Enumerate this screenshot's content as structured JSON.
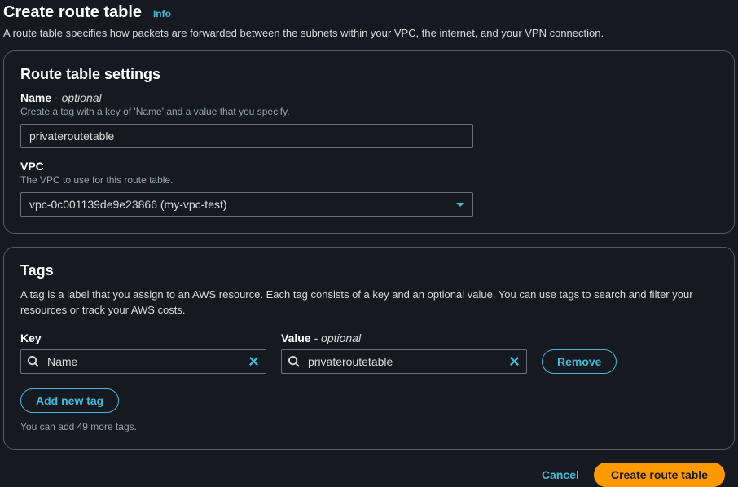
{
  "header": {
    "title": "Create route table",
    "info_label": "Info",
    "description": "A route table specifies how packets are forwarded between the subnets within your VPC, the internet, and your VPN connection."
  },
  "settings_panel": {
    "title": "Route table settings",
    "name_field": {
      "label": "Name",
      "optional_suffix": " - optional",
      "hint": "Create a tag with a key of 'Name' and a value that you specify.",
      "value": "privateroutetable"
    },
    "vpc_field": {
      "label": "VPC",
      "hint": "The VPC to use for this route table.",
      "selected": "vpc-0c001139de9e23866 (my-vpc-test)"
    }
  },
  "tags_panel": {
    "title": "Tags",
    "description": "A tag is a label that you assign to an AWS resource. Each tag consists of a key and an optional value. You can use tags to search and filter your resources or track your AWS costs.",
    "key_label": "Key",
    "value_label": "Value",
    "value_optional_suffix": " - optional",
    "rows": [
      {
        "key": "Name",
        "value": "privateroutetable"
      }
    ],
    "remove_label": "Remove",
    "add_label": "Add new tag",
    "limit_text": "You can add 49 more tags."
  },
  "footer": {
    "cancel_label": "Cancel",
    "submit_label": "Create route table"
  }
}
